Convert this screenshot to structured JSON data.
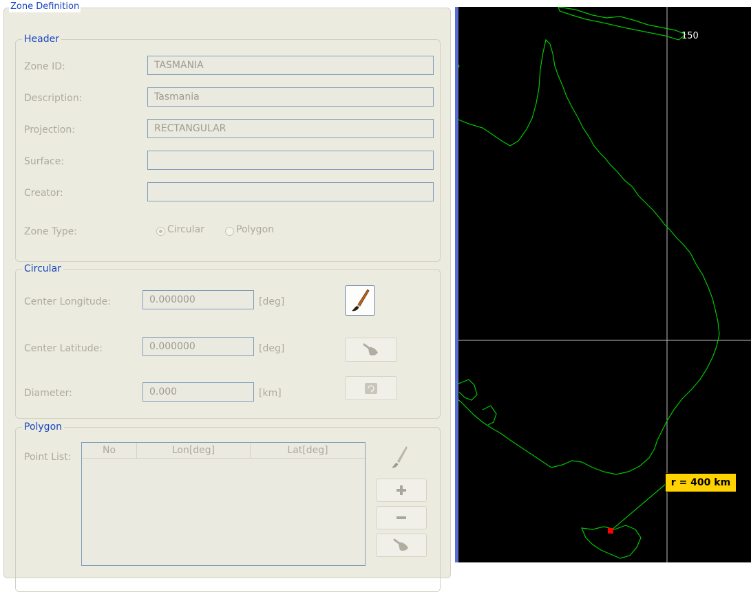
{
  "zone_definition": {
    "title": "Zone Definition",
    "header": {
      "title": "Header",
      "zone_id_label": "Zone ID:",
      "zone_id_value": "TASMANIA",
      "description_label": "Description:",
      "description_value": "Tasmania",
      "projection_label": "Projection:",
      "projection_value": "RECTANGULAR",
      "surface_label": "Surface:",
      "surface_value": "",
      "creator_label": "Creator:",
      "creator_value": "",
      "zone_type_label": "Zone Type:",
      "zone_type_options": [
        "Circular",
        "Polygon"
      ],
      "zone_type_selected": "Circular"
    },
    "circular": {
      "title": "Circular",
      "center_longitude_label": "Center Longitude:",
      "center_longitude_value": "0.000000",
      "center_longitude_unit": "[deg]",
      "center_latitude_label": "Center Latitude:",
      "center_latitude_value": "0.000000",
      "center_latitude_unit": "[deg]",
      "diameter_label": "Diameter:",
      "diameter_value": "0.000",
      "diameter_unit": "[km]"
    },
    "polygon": {
      "title": "Polygon",
      "point_list_label": "Point List:",
      "columns": [
        "No",
        "Lon[deg]",
        "Lat[deg]"
      ],
      "rows": []
    }
  },
  "map": {
    "longitude_label": "150",
    "radius_label": "r = 400 km",
    "coastline_color": "#00c800",
    "grid_color": "#bfbfbf",
    "marker_color": "#ff0000",
    "label_bg_color": "#ffd200"
  },
  "icons": {
    "draw": "paintbrush-icon",
    "clear": "broom-icon",
    "refresh": "refresh-icon",
    "add": "plus-icon",
    "remove": "minus-icon"
  }
}
